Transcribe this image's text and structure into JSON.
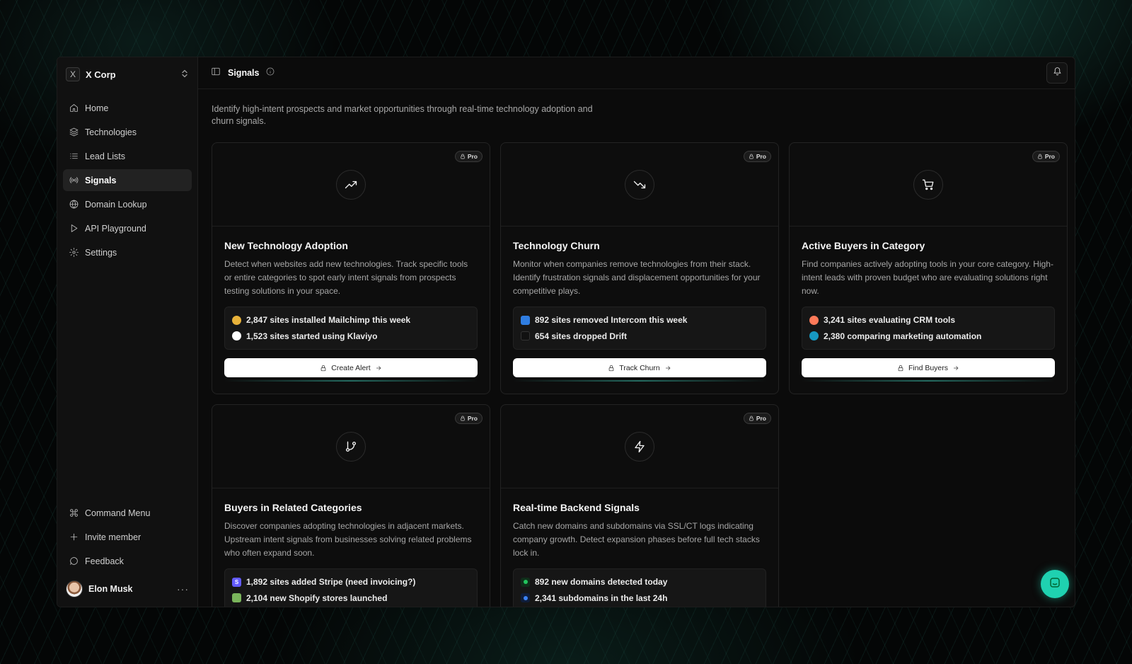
{
  "workspace": {
    "logo": "X",
    "name": "X Corp"
  },
  "nav": [
    {
      "label": "Home",
      "icon": "home-icon"
    },
    {
      "label": "Technologies",
      "icon": "layers-icon"
    },
    {
      "label": "Lead Lists",
      "icon": "list-icon"
    },
    {
      "label": "Signals",
      "icon": "radio-icon",
      "active": true
    },
    {
      "label": "Domain Lookup",
      "icon": "globe-icon"
    },
    {
      "label": "API Playground",
      "icon": "play-icon"
    },
    {
      "label": "Settings",
      "icon": "gear-icon"
    }
  ],
  "nav_bottom": [
    {
      "label": "Command Menu",
      "icon": "command-icon"
    },
    {
      "label": "Invite member",
      "icon": "plus-icon"
    },
    {
      "label": "Feedback",
      "icon": "message-icon"
    }
  ],
  "user": {
    "name": "Elon Musk",
    "more": "···"
  },
  "header": {
    "title": "Signals"
  },
  "description": "Identify high-intent prospects and market opportunities through real-time technology adoption and churn signals.",
  "cards": [
    {
      "badge": "Pro",
      "icon": "trending-up-icon",
      "title": "New Technology Adoption",
      "text": "Detect when websites add new technologies. Track specific tools or entire categories to spot early intent signals from prospects testing solutions in your space.",
      "stats": [
        {
          "text": "2,847 sites installed Mailchimp this week",
          "icon": "mailchimp-icon",
          "color": "#e8b23a"
        },
        {
          "text": "1,523 sites started using Klaviyo",
          "icon": "klaviyo-icon",
          "color": "#ffffff"
        }
      ],
      "action": "Create Alert"
    },
    {
      "badge": "Pro",
      "icon": "trending-down-icon",
      "title": "Technology Churn",
      "text": "Monitor when companies remove technologies from their stack. Identify frustration signals and displacement opportunities for your competitive plays.",
      "stats": [
        {
          "text": "892 sites removed Intercom this week",
          "icon": "intercom-icon",
          "color": "#2f7de1"
        },
        {
          "text": "654 sites dropped Drift",
          "icon": "drift-icon",
          "color": "#111111"
        }
      ],
      "action": "Track Churn"
    },
    {
      "badge": "Pro",
      "icon": "cart-icon",
      "title": "Active Buyers in Category",
      "text": "Find companies actively adopting tools in your core category. High-intent leads with proven budget who are evaluating solutions right now.",
      "stats": [
        {
          "text": "3,241 sites evaluating CRM tools",
          "icon": "hubspot-icon",
          "color": "#ff7a59"
        },
        {
          "text": "2,380 comparing marketing automation",
          "icon": "salesforce-icon",
          "color": "#1798c1"
        }
      ],
      "action": "Find Buyers"
    },
    {
      "badge": "Pro",
      "icon": "git-branch-icon",
      "title": "Buyers in Related Categories",
      "text": "Discover companies adopting technologies in adjacent markets. Upstream intent signals from businesses solving related problems who often expand soon.",
      "stats": [
        {
          "text": "1,892 sites added Stripe (need invoicing?)",
          "icon": "stripe-icon",
          "color": "#635bff"
        },
        {
          "text": "2,104 new Shopify stores launched",
          "icon": "shopify-icon",
          "color": "#7ab55c"
        }
      ]
    },
    {
      "badge": "Pro",
      "icon": "zap-icon",
      "title": "Real-time Backend Signals",
      "text": "Catch new domains and subdomains via SSL/CT logs indicating company growth. Detect expansion phases before full tech stacks lock in.",
      "stats": [
        {
          "text": "892 new domains detected today",
          "icon": "green-dot-icon",
          "color": "#22c55e"
        },
        {
          "text": "2,341 subdomains in the last 24h",
          "icon": "blue-dot-icon",
          "color": "#3b82f6"
        }
      ]
    }
  ]
}
